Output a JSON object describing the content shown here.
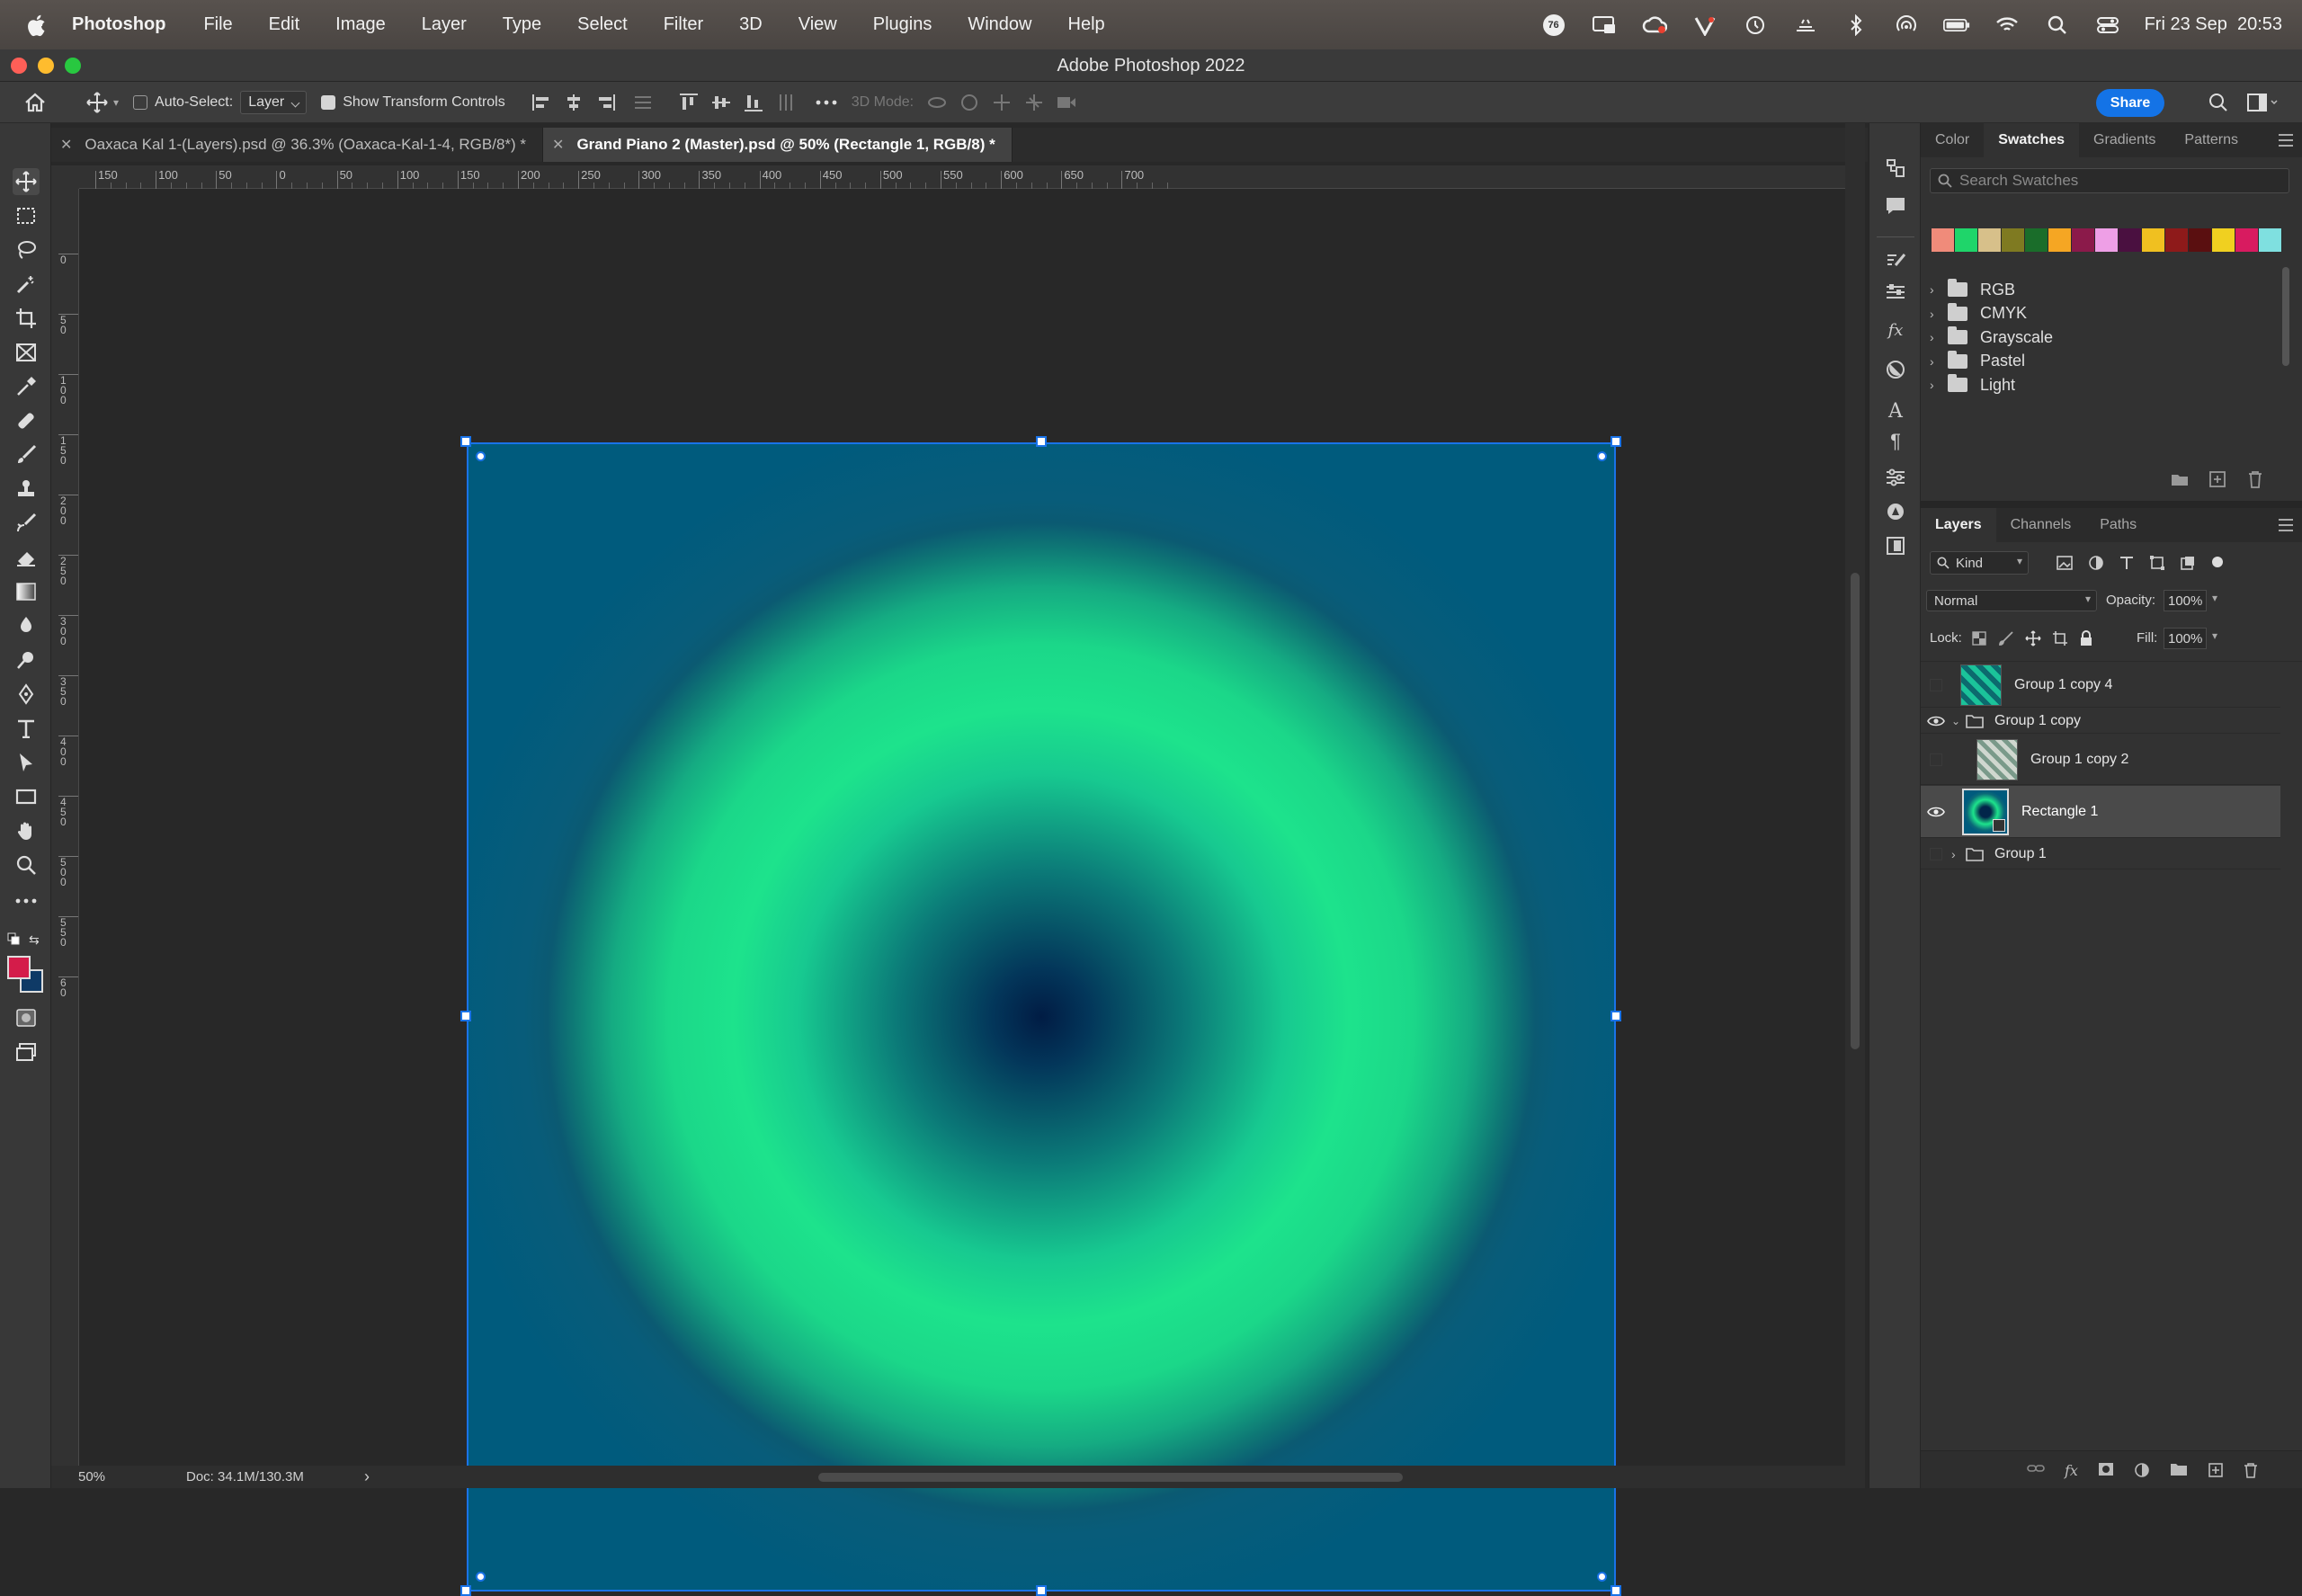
{
  "menubar": {
    "app_name": "Photoshop",
    "items": [
      "File",
      "Edit",
      "Image",
      "Layer",
      "Type",
      "Select",
      "Filter",
      "3D",
      "View",
      "Plugins",
      "Window",
      "Help"
    ],
    "clock": "Fri 23 Sep  20:53",
    "badge": "76"
  },
  "window": {
    "title": "Adobe Photoshop 2022"
  },
  "options": {
    "auto_select_label": "Auto-Select:",
    "auto_select_value": "Layer",
    "show_transform_label": "Show Transform Controls",
    "mode_3d_label": "3D Mode:",
    "share_label": "Share"
  },
  "tabs": [
    {
      "label": "Oaxaca Kal 1-(Layers).psd @ 36.3% (Oaxaca-Kal-1-4, RGB/8*) *",
      "active": false
    },
    {
      "label": "Grand Piano 2 (Master).psd @ 50% (Rectangle 1, RGB/8) *",
      "active": true
    }
  ],
  "ruler": {
    "h_ticks": [
      "150",
      "100",
      "50",
      "0",
      "50",
      "100",
      "150",
      "200",
      "250",
      "300",
      "350",
      "400",
      "450",
      "500",
      "550",
      "600",
      "650",
      "700"
    ],
    "v_ticks": [
      "0",
      "5\n0",
      "1\n0\n0",
      "1\n5\n0",
      "2\n0\n0",
      "2\n5\n0",
      "3\n0\n0",
      "3\n5\n0",
      "4\n0\n0",
      "4\n5\n0",
      "5\n0\n0",
      "5\n5\n0",
      "6\n0"
    ]
  },
  "status": {
    "zoom": "50%",
    "doc": "Doc: 34.1M/130.3M",
    "arrow": "›"
  },
  "swatches_panel": {
    "tabs": [
      "Color",
      "Swatches",
      "Gradients",
      "Patterns"
    ],
    "active_tab": "Swatches",
    "search_placeholder": "Search Swatches",
    "colors": [
      "#f08b7a",
      "#1fd56a",
      "#d7c08a",
      "#7f7a21",
      "#1a6d2a",
      "#f5a623",
      "#8b1a4a",
      "#ee9fe6",
      "#4a1040",
      "#f0c020",
      "#8e1a1a",
      "#5a0f10",
      "#f0d020",
      "#d81b60",
      "#7fe0e0"
    ],
    "groups": [
      "RGB",
      "CMYK",
      "Grayscale",
      "Pastel",
      "Light"
    ]
  },
  "layers_panel": {
    "tabs": [
      "Layers",
      "Channels",
      "Paths"
    ],
    "active_tab": "Layers",
    "filter_kind": "Kind",
    "blend_mode": "Normal",
    "opacity_label": "Opacity:",
    "opacity_value": "100%",
    "lock_label": "Lock:",
    "fill_label": "Fill:",
    "fill_value": "100%",
    "layers": [
      {
        "name": "Group 1 copy 4",
        "visible": false,
        "type": "pixel"
      },
      {
        "name": "Group 1 copy",
        "visible": true,
        "type": "group",
        "expanded": true
      },
      {
        "name": "Group 1 copy 2",
        "visible": false,
        "type": "pixel"
      },
      {
        "name": "Rectangle 1",
        "visible": true,
        "type": "shape",
        "selected": true
      },
      {
        "name": "Group 1",
        "visible": false,
        "type": "group",
        "expanded": false
      }
    ]
  },
  "colors": {
    "foreground": "#d41c4a",
    "background": "#0f3a66",
    "accent": "#1473e6",
    "canvas_bg": "#005b7d"
  }
}
